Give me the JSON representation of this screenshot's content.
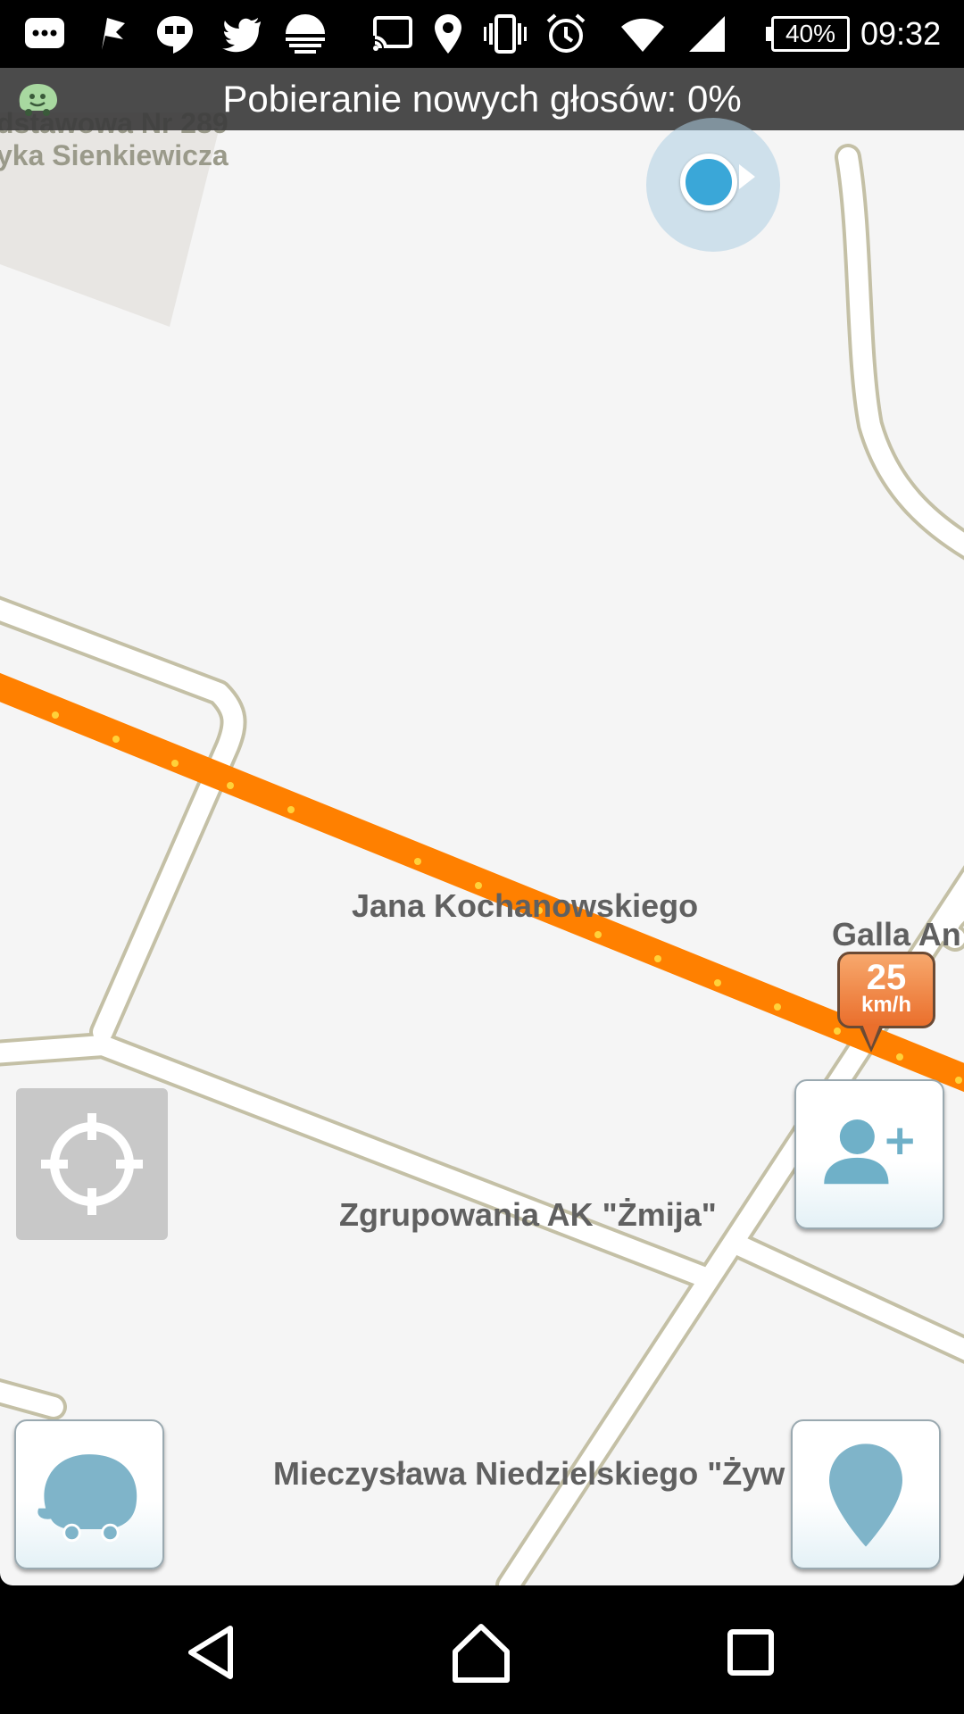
{
  "status_bar": {
    "battery": "40%",
    "time": "09:32",
    "icons": [
      "messenger-icon",
      "flag-icon",
      "hangouts-icon",
      "twitter-icon",
      "sunset-icon",
      "cast-icon",
      "location-icon",
      "vibrate-icon",
      "alarm-icon",
      "wifi-icon",
      "signal-icon",
      "battery-icon"
    ]
  },
  "banner": {
    "text": "Pobieranie nowych głosów: 0%"
  },
  "map": {
    "poi_line1": "dstawowa Nr 289",
    "poi_line2": "yka Sienkiewicza",
    "streets": {
      "jana": "Jana Kochanowskiego",
      "galla": "Galla An",
      "zgrupowania": "Zgrupowania AK \"Żmija\"",
      "mieczyslawa": "Mieczysława Niedzielskiego \"Żyw"
    },
    "speed": {
      "value": "25",
      "unit": "km/h"
    },
    "route_color": "#ff8000"
  },
  "nav_bar": {
    "icons": [
      "back-icon",
      "home-icon",
      "recents-icon"
    ]
  }
}
